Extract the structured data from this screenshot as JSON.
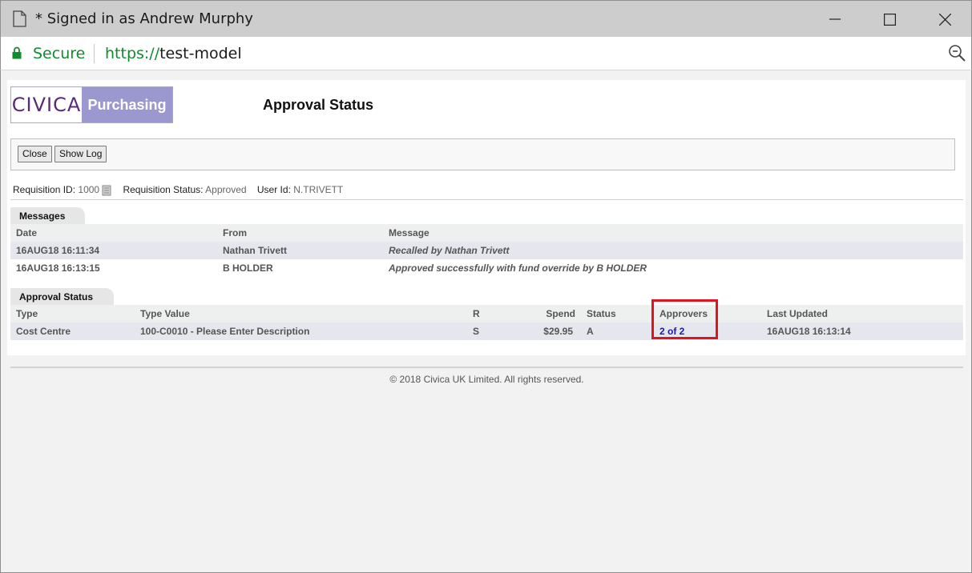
{
  "window": {
    "title": "* Signed in as Andrew Murphy"
  },
  "address_bar": {
    "secure_label": "Secure",
    "url_scheme": "https://",
    "url_host": "test-model"
  },
  "header": {
    "logo_left": "CIVICA",
    "logo_right": "Purchasing",
    "page_title": "Approval Status"
  },
  "toolbar": {
    "close_label": "Close",
    "show_log_label": "Show Log"
  },
  "requisition": {
    "id_label": "Requisition ID:",
    "id_value": "1000",
    "status_label": "Requisition Status:",
    "status_value": "Approved",
    "user_label": "User Id:",
    "user_value": "N.TRIVETT"
  },
  "messages": {
    "tab_label": "Messages",
    "columns": [
      "Date",
      "From",
      "Message"
    ],
    "rows": [
      {
        "date": "16AUG18 16:11:34",
        "from": "Nathan Trivett",
        "message": "Recalled by Nathan Trivett"
      },
      {
        "date": "16AUG18 16:13:15",
        "from": "B HOLDER",
        "message": "Approved successfully with fund override by B HOLDER"
      }
    ]
  },
  "approval_status": {
    "tab_label": "Approval Status",
    "columns": [
      "Type",
      "Type Value",
      "R",
      "Spend",
      "Status",
      "Approvers",
      "Last Updated"
    ],
    "rows": [
      {
        "type": "Cost Centre",
        "type_value": "100-C0010 - Please Enter Description",
        "r": "S",
        "spend": "$29.95",
        "status": "A",
        "approvers": "2 of 2",
        "last_updated": "16AUG18 16:13:14"
      }
    ]
  },
  "footer": {
    "copyright": "© 2018 Civica UK Limited. All rights reserved."
  },
  "colors": {
    "secure_green": "#128a2e",
    "logo_purple": "#9b98cf",
    "highlight_red": "#e0141e",
    "link_blue": "#1a1aa6"
  },
  "icons": [
    "document-icon",
    "minimize-icon",
    "maximize-icon",
    "close-icon",
    "lock-icon",
    "zoom-icon",
    "requisition-document-icon"
  ]
}
